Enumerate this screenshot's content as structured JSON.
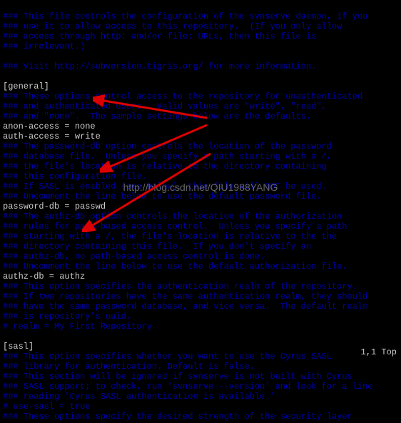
{
  "comments": {
    "c1": "### This file controls the configuration of the svnserve daemon, if you",
    "c2": "### use it to allow access to this repository.  (If you only allow",
    "c3": "### access through http: and/or file: URLs, then this file is",
    "c4": "### irrelevant.)",
    "c5": "### Visit http://subversion.tigris.org/ for more information.",
    "c6": "### These options control access to the repository for unauthenticated",
    "c7": "### and authenticated users.  Valid values are \"write\", \"read\",",
    "c8": "### and \"none\".  The sample settings below are the defaults.",
    "c9": "### The password-db option controls the location of the password",
    "c10": "### database file.  Unless you specify a path starting with a /,",
    "c11": "### the file's location is relative to the directory containing",
    "c12": "### this configuration file.",
    "c13": "### If SASL is enabled (see below), this file will NOT be used.",
    "c14": "### Uncomment the line below to use the default password file.",
    "c15": "### The authz-db option controls the location of the authorization",
    "c16": "### rules for path-based access control.  Unless you specify a path",
    "c17": "### starting with a /, the file's location is relative to the the",
    "c18": "### directory containing this file.  If you don't specify an",
    "c19": "### authz-db, no path-based access control is done.",
    "c20": "### Uncomment the line below to use the default authorization file.",
    "c21": "### This option specifies the authentication realm of the repository.",
    "c22": "### If two repositories have the same authentication realm, they should",
    "c23": "### have the same password database, and vice versa.  The default realm",
    "c24": "### is repository's uuid.",
    "c25": "# realm = My First Repository",
    "c26": "### This option specifies whether you want to use the Cyrus SASL",
    "c27": "### library for authentication. Default is false.",
    "c28": "### This section will be ignored if svnserve is not built with Cyrus",
    "c29": "### SASL support; to check, run 'svnserve --version' and look for a line",
    "c30": "### reading 'Cyrus SASL authentication is available.'",
    "c31": "# use-sasl = true",
    "c32": "### These options specify the desired strength of the security layer"
  },
  "sections": {
    "general": "[general]",
    "sasl": "[sasl]"
  },
  "settings": {
    "anon": "anon-access = none",
    "auth": "auth-access = write",
    "pwdb": "password-db = passwd",
    "azdb": "authz-db = authz"
  },
  "watermark": "http://blog.csdn.net/QIU1988YANG",
  "status": "1,1           Top"
}
